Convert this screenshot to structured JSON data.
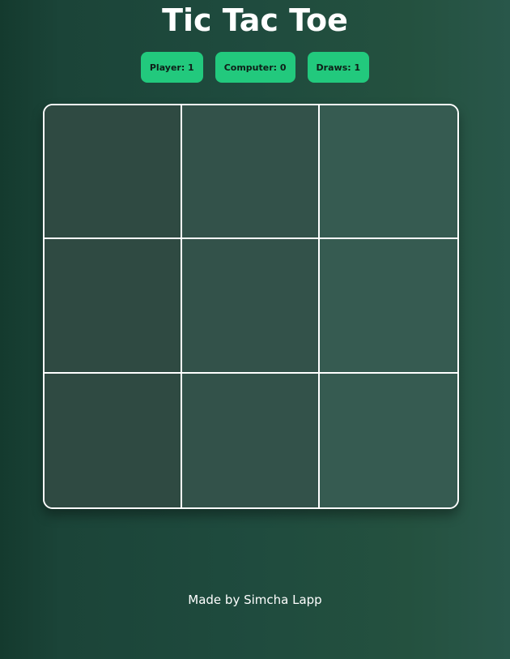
{
  "title": "Tic Tac Toe",
  "scores": {
    "player": "Player: 1",
    "computer": "Computer: 0",
    "draws": "Draws: 1"
  },
  "board": {
    "cells": [
      "",
      "",
      "",
      "",
      "",
      "",
      "",
      "",
      ""
    ]
  },
  "footer": "Made by Simcha Lapp",
  "colors": {
    "accent": "#22c97d",
    "board_line": "#ffffff"
  }
}
